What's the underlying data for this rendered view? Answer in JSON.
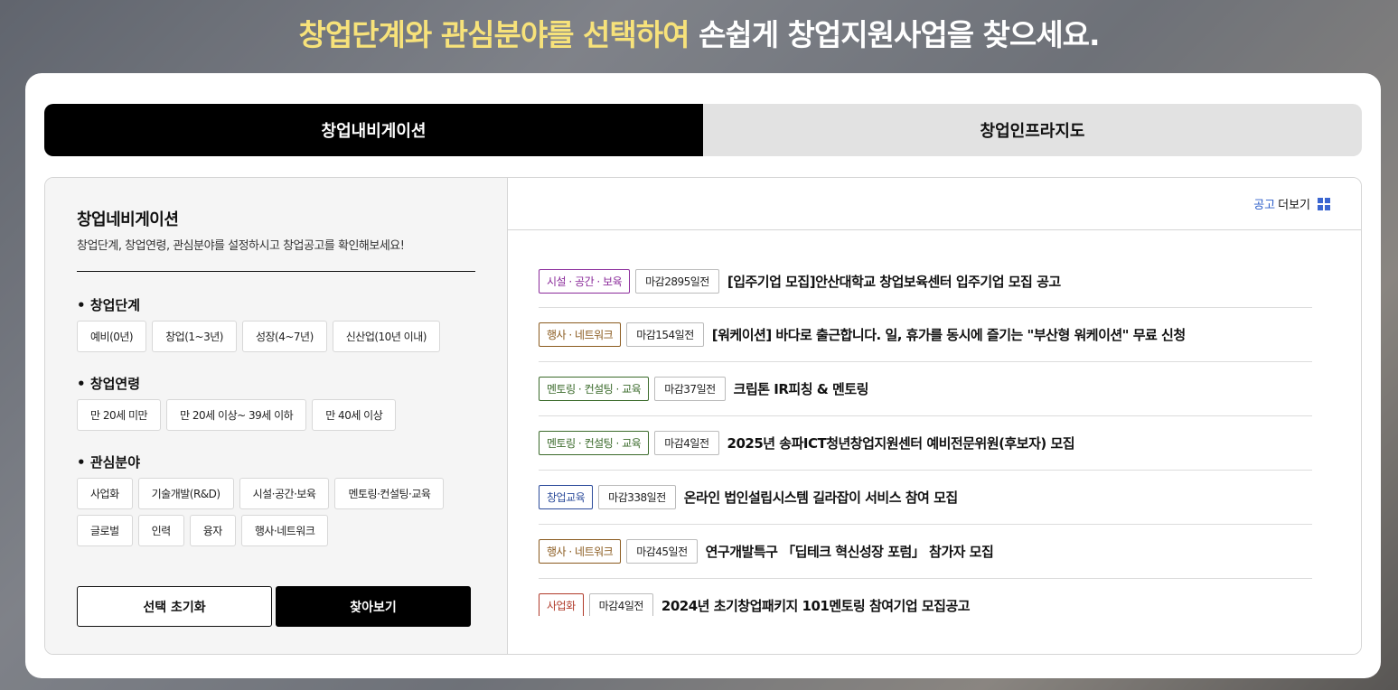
{
  "headline": {
    "highlight": "창업단계와 관심분야를 선택하여",
    "rest": " 손쉽게 창업지원사업을 찾으세요."
  },
  "tabs": [
    {
      "label": "창업내비게이션",
      "active": true
    },
    {
      "label": "창업인프라지도",
      "active": false
    }
  ],
  "filter": {
    "title": "창업네비게이션",
    "description": "창업단계, 창업연령, 관심분야를 설정하시고 창업공고를 확인해보세요!",
    "stage": {
      "label": "창업단계",
      "options": [
        "예비(0년)",
        "창업(1~3년)",
        "성장(4~7년)",
        "신산업(10년 이내)"
      ]
    },
    "age": {
      "label": "창업연령",
      "options": [
        "만 20세 미만",
        "만 20세 이상~ 39세 이하",
        "만 40세 이상"
      ]
    },
    "field": {
      "label": "관심분야",
      "options": [
        "사업화",
        "기술개발(R&D)",
        "시설·공간·보육",
        "멘토링·컨설팅·교육",
        "글로벌",
        "인력",
        "융자",
        "행사·네트워크"
      ]
    },
    "reset_label": "선택 초기화",
    "search_label": "찾아보기"
  },
  "notices": {
    "more_blue": "공고",
    "more_rest": "더보기",
    "items": [
      {
        "category": "시설 · 공간 · 보육",
        "color": "#8a2a9a",
        "dday": "마감2895일전",
        "title": "[입주기업 모집]안산대학교 창업보육센터 입주기업 모집 공고"
      },
      {
        "category": "행사 · 네트워크",
        "color": "#8a5a1e",
        "dday": "마감154일전",
        "title": "[워케이션] 바다로 출근합니다. 일, 휴가를 동시에 즐기는 \"부산형 워케이션\" 무료 신청"
      },
      {
        "category": "멘토링 · 컨설팅 · 교육",
        "color": "#3a6a2a",
        "dday": "마감37일전",
        "title": "크립톤 IR피칭 & 멘토링"
      },
      {
        "category": "멘토링 · 컨설팅 · 교육",
        "color": "#3a6a2a",
        "dday": "마감4일전",
        "title": "2025년 송파ICT청년창업지원센터 예비전문위원(후보자) 모집"
      },
      {
        "category": "창업교육",
        "color": "#2a4a9a",
        "dday": "마감338일전",
        "title": "온라인 법인설립시스템 길라잡이 서비스 참여 모집"
      },
      {
        "category": "행사 · 네트워크",
        "color": "#8a5a1e",
        "dday": "마감45일전",
        "title": "연구개발특구 「딥테크 혁신성장 포럼」 참가자 모집"
      },
      {
        "category": "사업화",
        "color": "#b03a2a",
        "dday": "마감4일전",
        "title": "2024년 초기창업패키지 101멘토링 참여기업 모집공고"
      }
    ]
  }
}
